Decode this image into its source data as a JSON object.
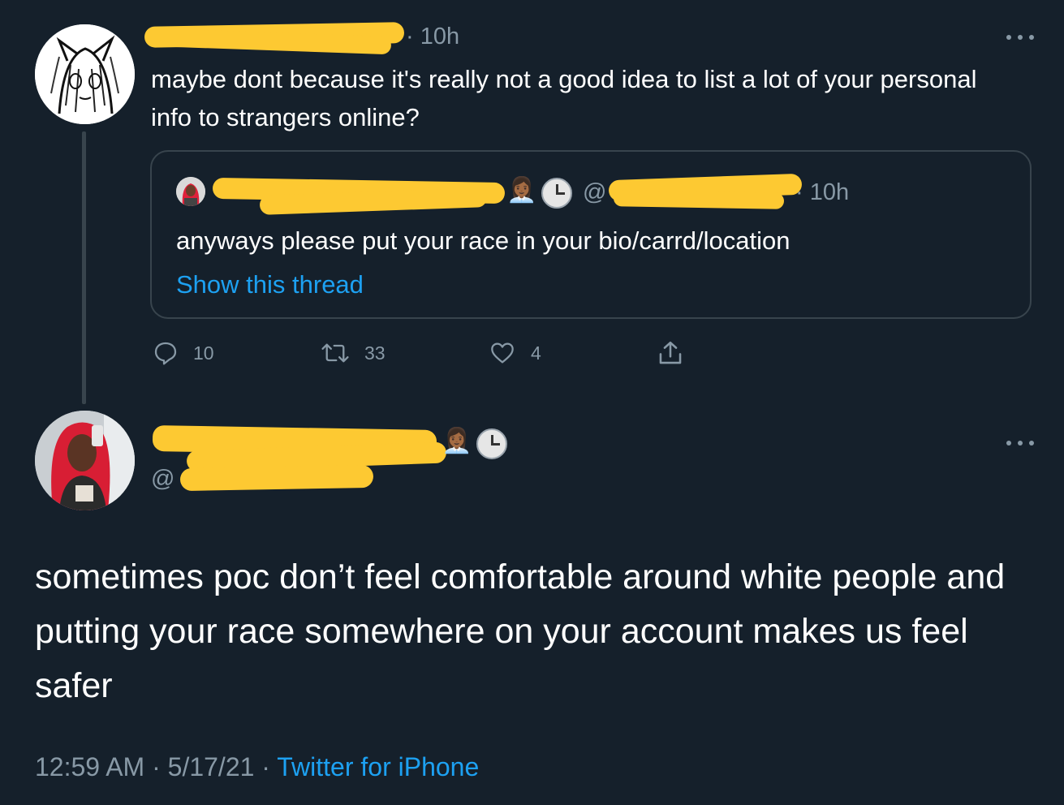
{
  "parent_tweet": {
    "timestamp": "10h",
    "text": "maybe dont because it's really not a good idea to list a lot of your personal info to strangers online?",
    "quoted": {
      "handle_prefix": "@",
      "timestamp": "10h",
      "emojis": [
        "woman-technologist-emoji",
        "clock-emoji"
      ],
      "text": "anyways please put your race in your bio/carrd/location",
      "show_thread_label": "Show this thread"
    },
    "actions": {
      "replies": "10",
      "retweets": "33",
      "likes": "4"
    }
  },
  "main_tweet": {
    "handle_prefix": "@",
    "emojis": [
      "woman-technologist-emoji",
      "clock-emoji"
    ],
    "text": "sometimes poc don’t feel comfortable around white people and putting your race somewhere on your account makes us feel safer",
    "time": "12:59 AM",
    "date": "5/17/21",
    "source": "Twitter for iPhone",
    "separator": " · "
  },
  "colors": {
    "background": "#15202b",
    "text_primary": "#ffffff",
    "text_secondary": "#8899a6",
    "link": "#1da1f2",
    "border": "#38444d",
    "redaction": "#fdc932"
  }
}
